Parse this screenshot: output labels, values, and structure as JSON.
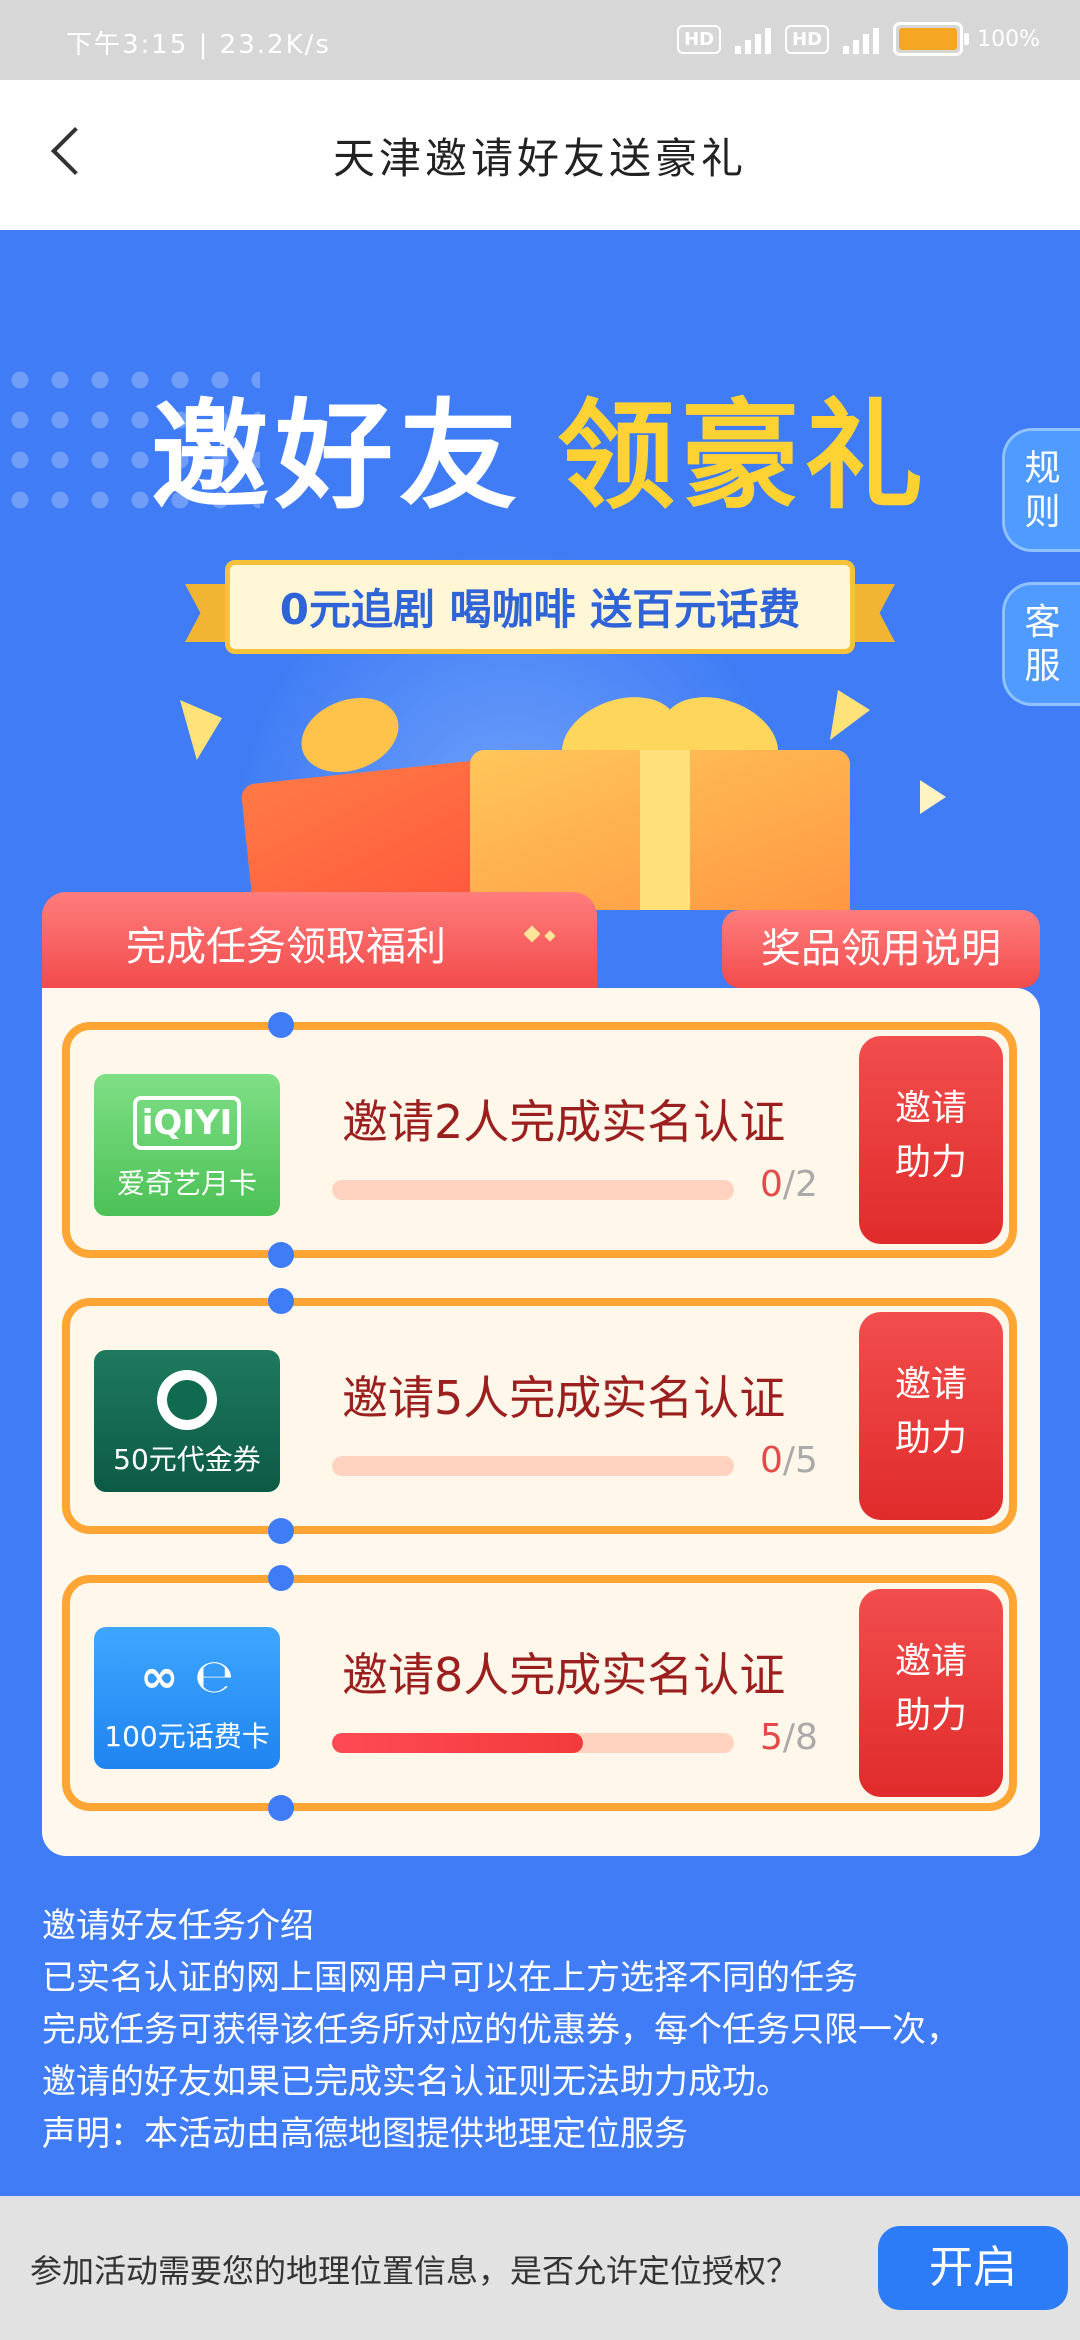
{
  "status_bar": {
    "left_text": "下午3:15 | 23.2K/s",
    "hd_label": "HD",
    "battery_text": "100%"
  },
  "top_bar": {
    "title": "天津邀请好友送豪礼"
  },
  "hero": {
    "headline_white": "邀好友",
    "headline_yellow": "领豪礼",
    "ribbon_text": "0元追剧 喝咖啡 送百元话费"
  },
  "side_buttons": {
    "rules": [
      "规",
      "则"
    ],
    "service": [
      "客",
      "服"
    ]
  },
  "tabs": {
    "left": "完成任务领取福利",
    "right": "奖品领用说明"
  },
  "tasks": [
    {
      "badge_logo": "iQIYI",
      "badge_caption": "爱奇艺月卡",
      "title": "邀请2人完成实名认证",
      "done": "0",
      "total": "/2",
      "progress": 0,
      "button": [
        "邀请",
        "助力"
      ]
    },
    {
      "badge_logo": "",
      "badge_caption": "50元代金券",
      "title": "邀请5人完成实名认证",
      "done": "0",
      "total": "/5",
      "progress": 0,
      "button": [
        "邀请",
        "助力"
      ]
    },
    {
      "badge_logo": "∞ ℮",
      "badge_caption": "100元话费卡",
      "title": "邀请8人完成实名认证",
      "done": "5",
      "total": "/8",
      "progress": 0.625,
      "button": [
        "邀请",
        "助力"
      ]
    }
  ],
  "intro": {
    "heading": "邀请好友任务介绍",
    "lines": [
      "已实名认证的网上国网用户可以在上方选择不同的任务",
      "完成任务可获得该任务所对应的优惠券，每个任务只限一次，",
      "邀请的好友如果已完成实名认证则无法助力成功。",
      "声明：本活动由高德地图提供地理定位服务"
    ]
  },
  "location_prompt": {
    "message": "参加活动需要您的地理位置信息，是否允许定位授权？",
    "button": "开启"
  },
  "colors": {
    "background_blue": "#3f7cf5",
    "accent_orange": "#ffa533",
    "accent_red": "#e02b2b",
    "headline_yellow": "#ffd234"
  }
}
